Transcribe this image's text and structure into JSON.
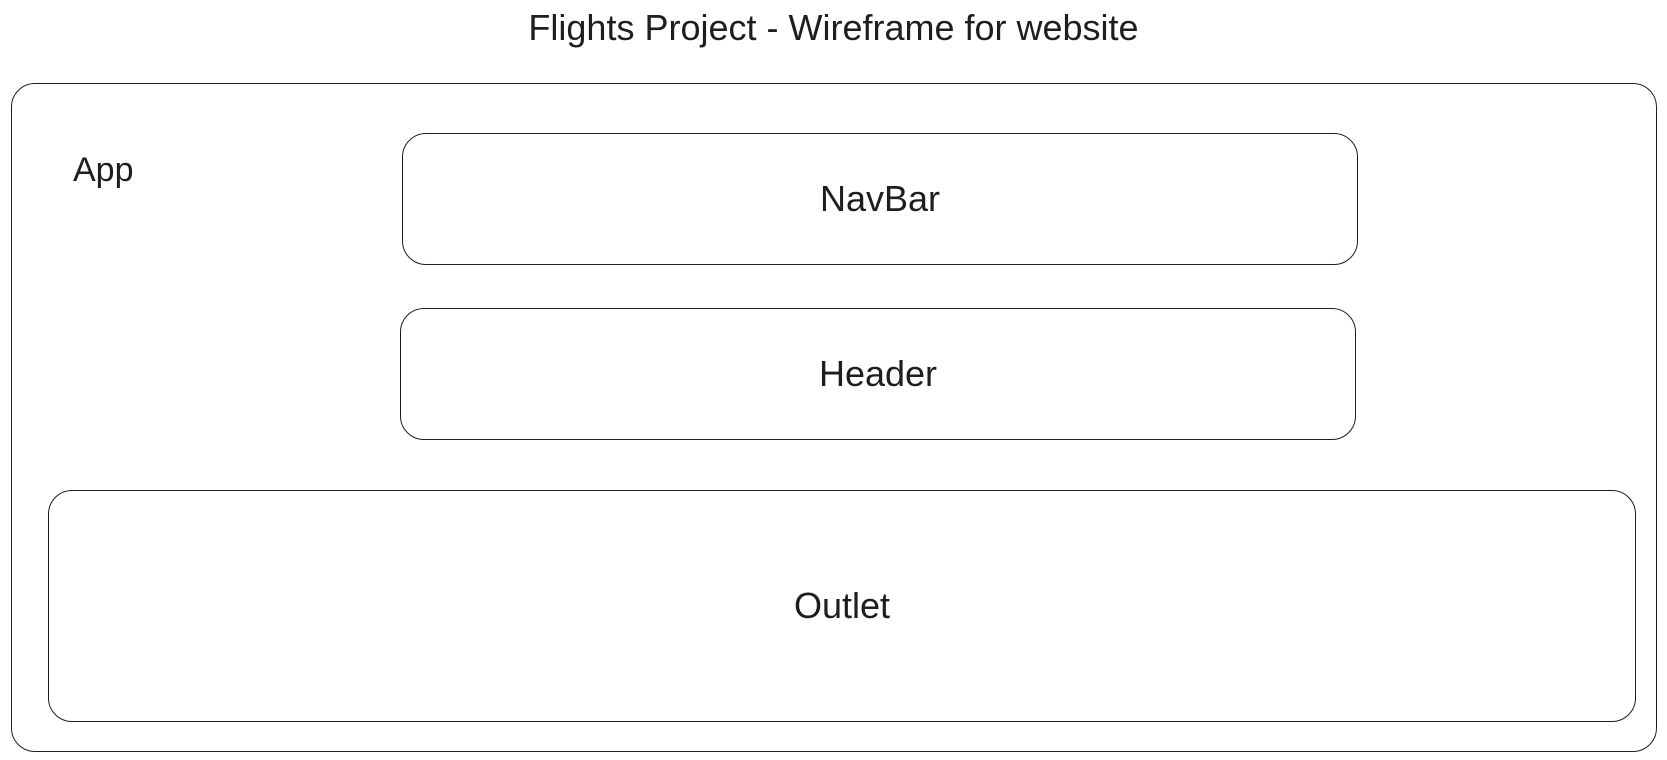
{
  "title": "Flights Project - Wireframe for website",
  "app": {
    "label": "App"
  },
  "components": {
    "navbar": "NavBar",
    "header": "Header",
    "outlet": "Outlet"
  },
  "colors": {
    "stroke": "#1e1e1e",
    "background": "#ffffff"
  }
}
